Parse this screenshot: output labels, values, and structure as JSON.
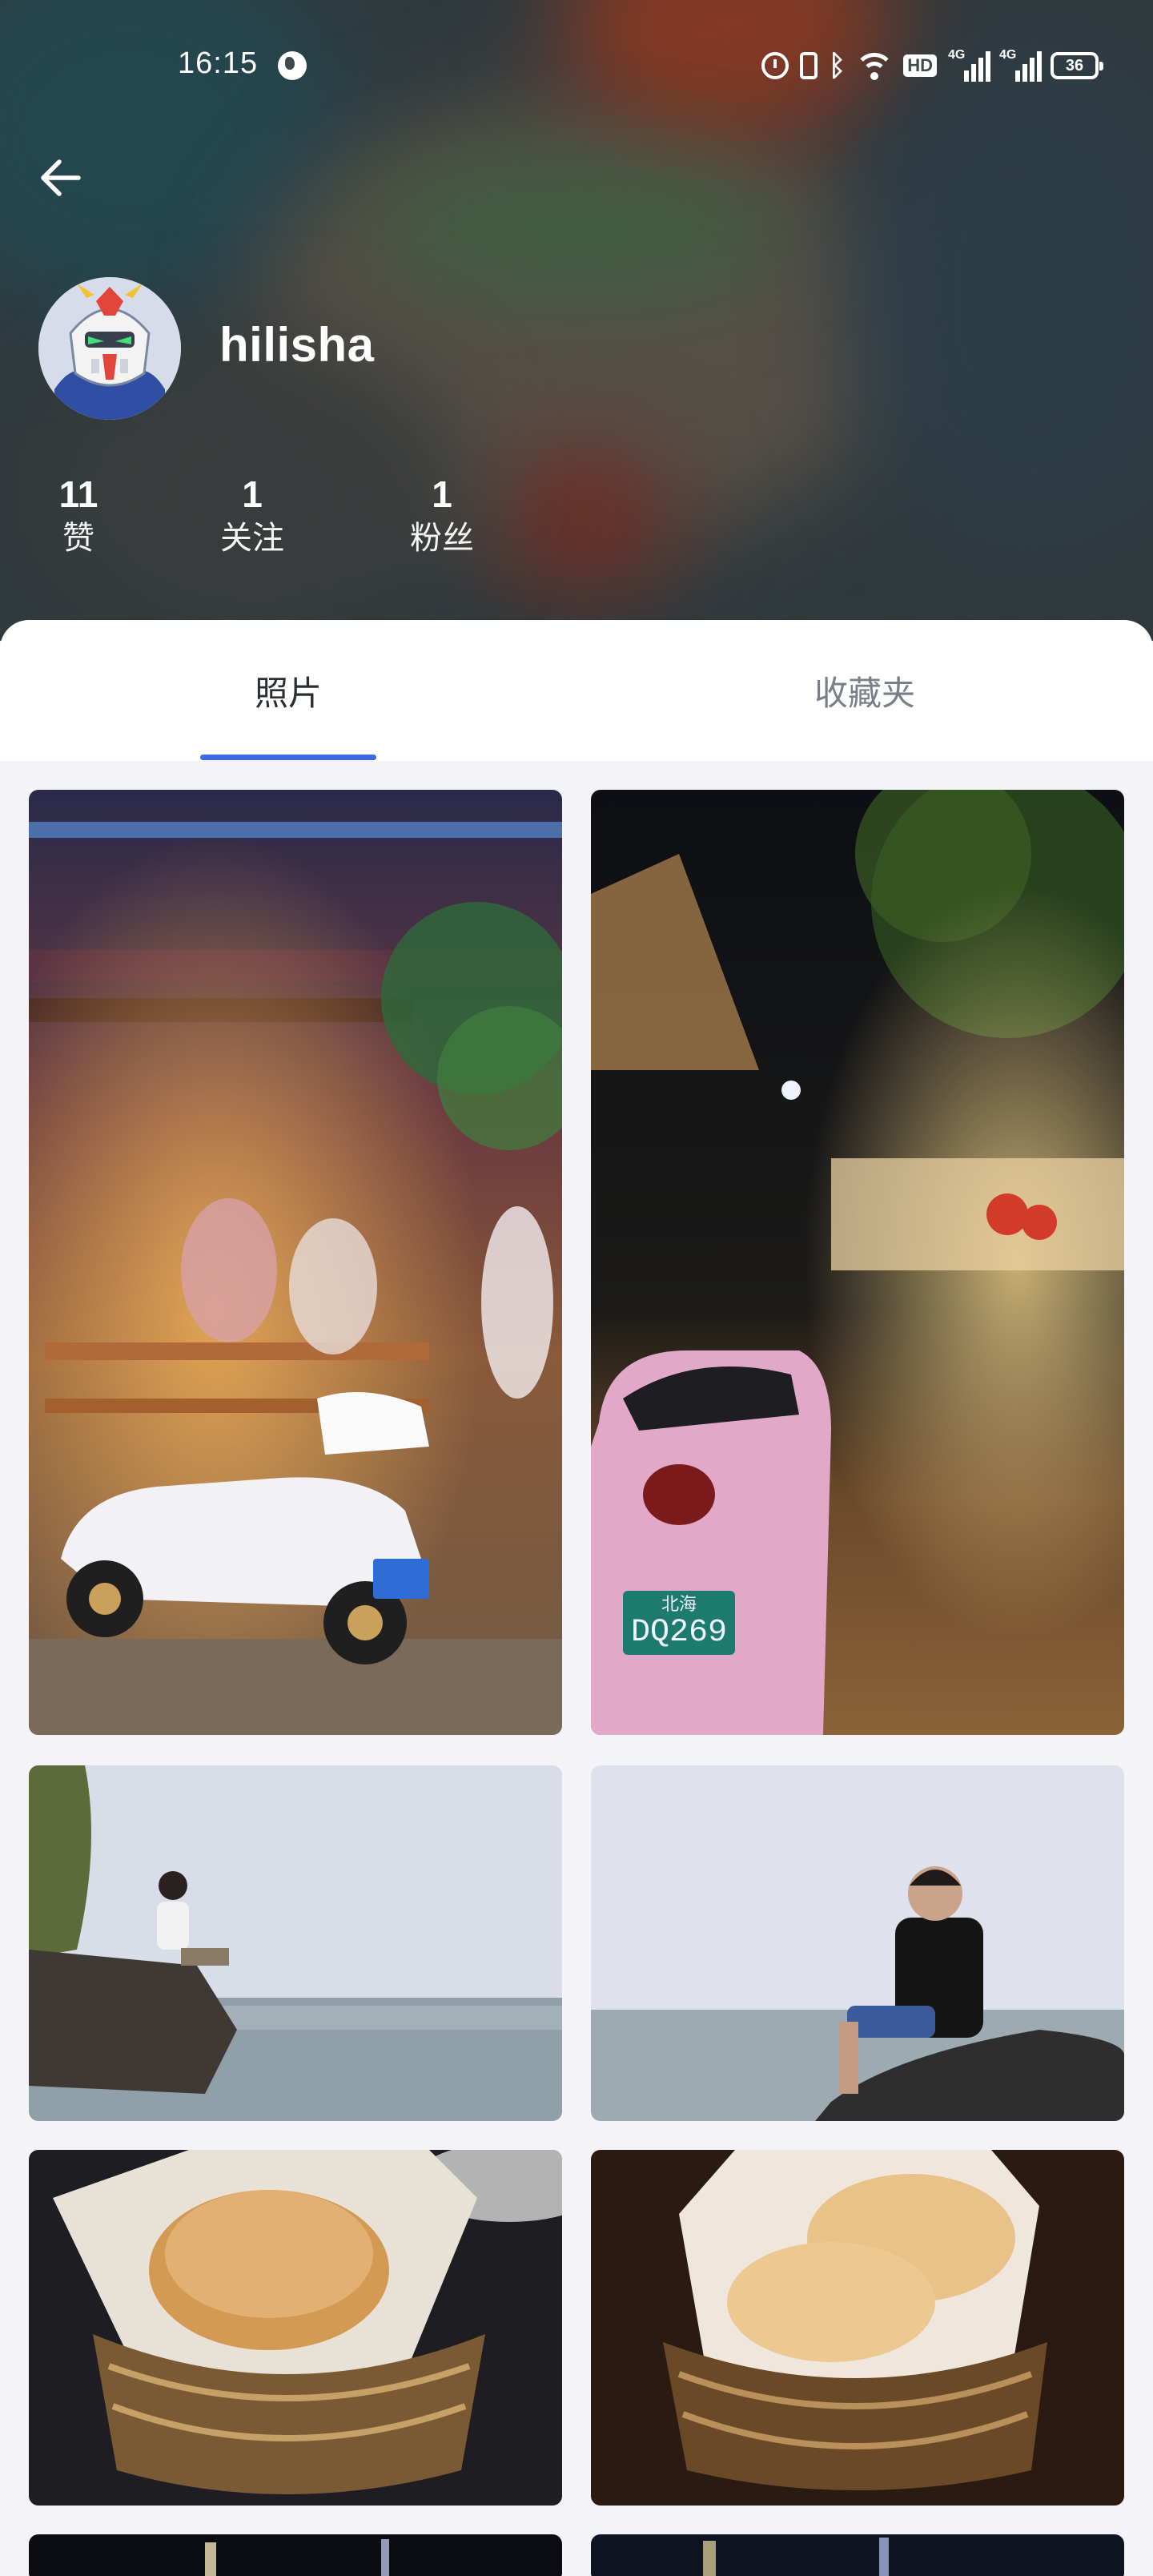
{
  "status_bar": {
    "time": "16:15",
    "network_label": "4G",
    "hd_label": "HD",
    "battery": "36"
  },
  "profile": {
    "username": "hilisha",
    "stats": [
      {
        "value": "11",
        "label": "赞"
      },
      {
        "value": "1",
        "label": "关注"
      },
      {
        "value": "1",
        "label": "粉丝"
      }
    ]
  },
  "tabs": {
    "photos": "照片",
    "favorites": "收藏夹",
    "active": "photos"
  },
  "icons": {
    "back": "back-arrow-icon",
    "avatar": "robot-avatar"
  },
  "colors": {
    "accent": "#3b6ae6",
    "tab_active": "#2a2d33",
    "tab_inactive": "#7a7e88",
    "page_bg": "#f4f4f8"
  },
  "photos": [
    {
      "plate_text": "DQ269",
      "plate_region": "北海"
    }
  ]
}
